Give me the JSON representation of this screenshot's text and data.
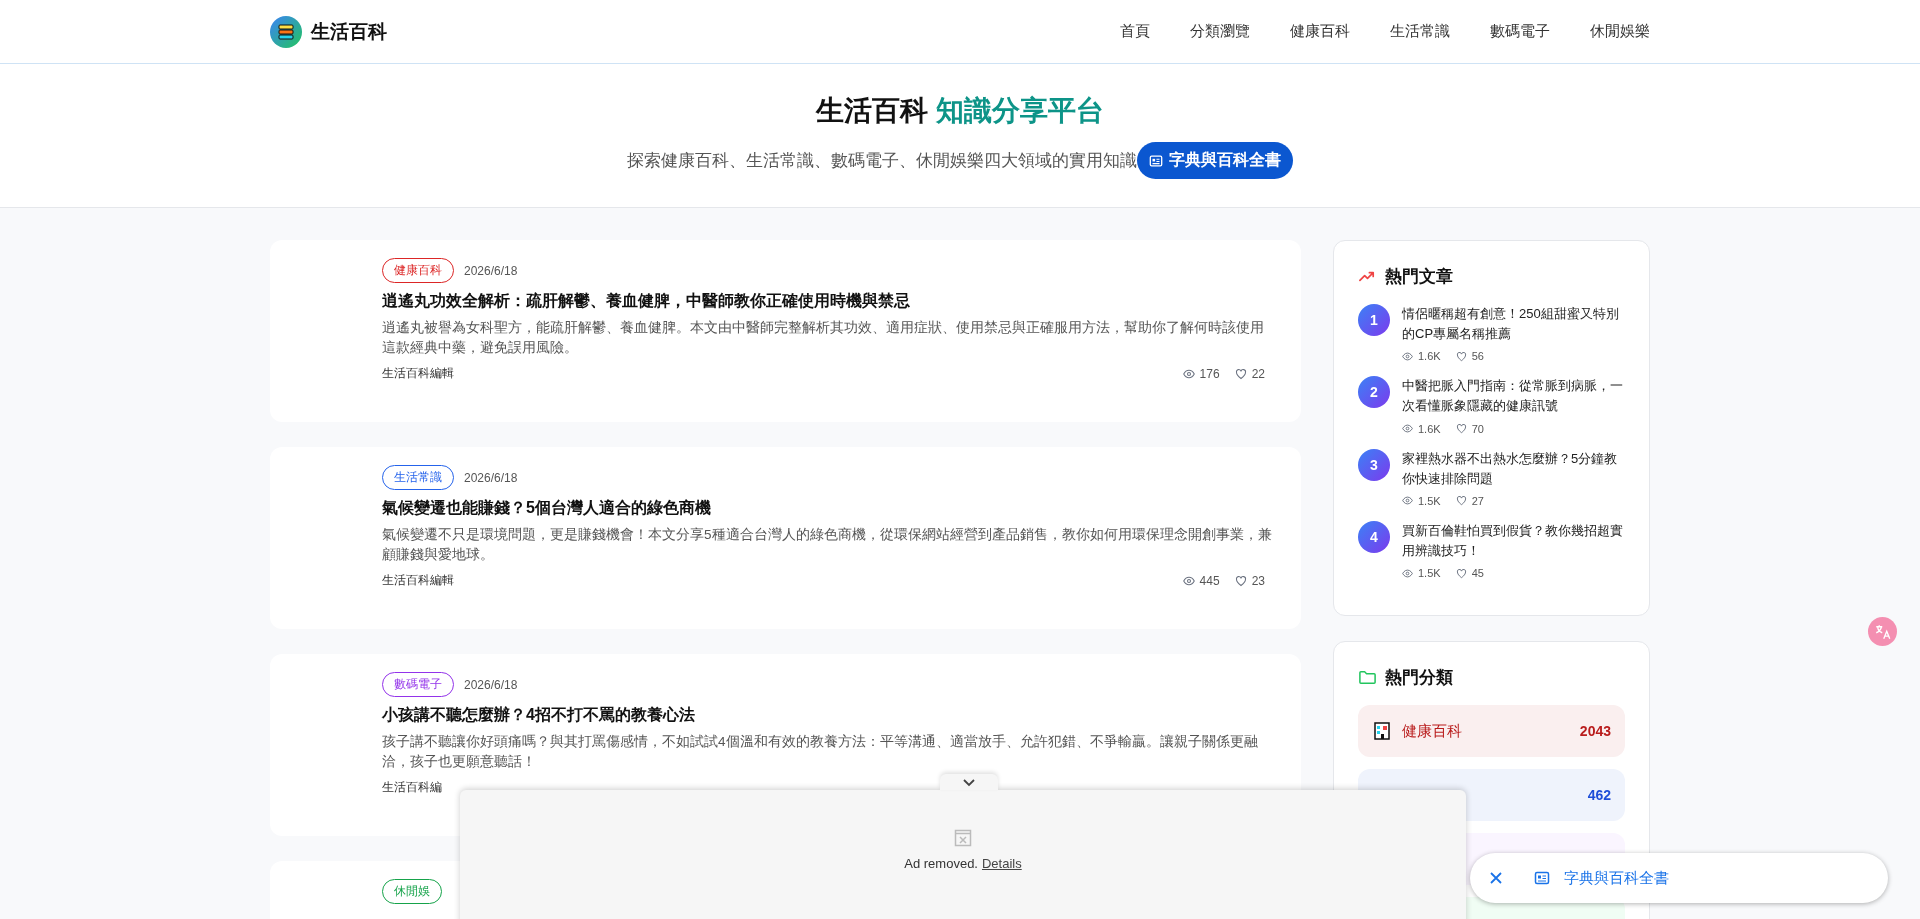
{
  "header": {
    "site_name": "生活百科",
    "nav": [
      {
        "label": "首頁"
      },
      {
        "label": "分類瀏覽"
      },
      {
        "label": "健康百科"
      },
      {
        "label": "生活常識"
      },
      {
        "label": "數碼電子"
      },
      {
        "label": "休閒娛樂"
      }
    ]
  },
  "hero": {
    "title": "生活百科",
    "title_accent": "知識分享平台",
    "subtitle": "探索健康百科、生活常識、數碼電子、休閒娛樂四大領域的實用知識",
    "chip": "字典與百科全書"
  },
  "articles": [
    {
      "tag": "健康百科",
      "color": "#dc2626",
      "date": "2026/6/18",
      "title": "逍遙丸功效全解析：疏肝解鬱、養血健脾，中醫師教你正確使用時機與禁忌",
      "excerpt": "逍遙丸被譽為女科聖方，能疏肝解鬱、養血健脾。本文由中醫師完整解析其功效、適用症狀、使用禁忌與正確服用方法，幫助你了解何時該使用這款經典中藥，避免誤用風險。",
      "author": "生活百科編輯",
      "views": "176",
      "likes": "22"
    },
    {
      "tag": "生活常識",
      "color": "#2563eb",
      "date": "2026/6/18",
      "title": "氣候變遷也能賺錢？5個台灣人適合的綠色商機",
      "excerpt": "氣候變遷不只是環境問題，更是賺錢機會！本文分享5種適合台灣人的綠色商機，從環保網站經營到產品銷售，教你如何用環保理念開創事業，兼顧賺錢與愛地球。",
      "author": "生活百科編輯",
      "views": "445",
      "likes": "23"
    },
    {
      "tag": "數碼電子",
      "color": "#9333ea",
      "date": "2026/6/18",
      "title": "小孩講不聽怎麼辦？4招不打不罵的教養心法",
      "excerpt": "孩子講不聽讓你好頭痛嗎？與其打罵傷感情，不如試試4個溫和有效的教養方法：平等溝通、適當放手、允許犯錯、不爭輸贏。讓親子關係更融洽，孩子也更願意聽話！",
      "author": "生活百科編"
    },
    {
      "tag": "休閒娛",
      "color": "#16a34a"
    }
  ],
  "popular": {
    "title": "熱門文章",
    "items": [
      {
        "rank": "1",
        "title": "情侶暱稱超有創意！250組甜蜜又特別的CP專屬名稱推薦",
        "views": "1.6K",
        "likes": "56"
      },
      {
        "rank": "2",
        "title": "中醫把脈入門指南：從常脈到病脈，一次看懂脈象隱藏的健康訊號",
        "views": "1.6K",
        "likes": "70"
      },
      {
        "rank": "3",
        "title": "家裡熱水器不出熱水怎麼辦？5分鐘教你快速排除問題",
        "views": "1.5K",
        "likes": "27"
      },
      {
        "rank": "4",
        "title": "買新百倫鞋怕買到假貨？教你幾招超實用辨識技巧！",
        "views": "1.5K",
        "likes": "45"
      }
    ]
  },
  "categories": {
    "title": "熱門分類",
    "items": [
      {
        "label": "健康百科",
        "count": "2043",
        "color": "#b91c1c"
      },
      {
        "count": "462",
        "color": "#1d4ed8"
      },
      {
        "color": "#faf5ff"
      },
      {
        "color": "#f0fdf4"
      }
    ]
  },
  "ad_overlay": {
    "message": "Ad removed.",
    "link": "Details"
  },
  "floating_chip": {
    "label": "字典與百科全書"
  }
}
